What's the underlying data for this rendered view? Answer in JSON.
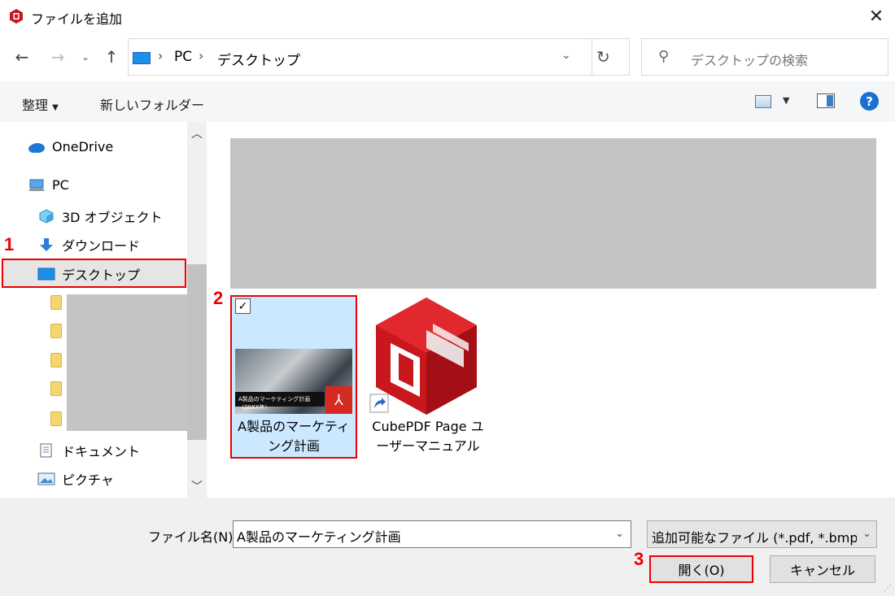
{
  "window": {
    "title": "ファイルを追加"
  },
  "nav": {
    "crumbs": [
      "PC",
      "デスクトップ"
    ],
    "search_placeholder": "デスクトップの検索"
  },
  "toolbar": {
    "organize": "整理",
    "new_folder": "新しいフォルダー"
  },
  "sidebar": {
    "onedrive": "OneDrive",
    "pc": "PC",
    "objects3d": "3D オブジェクト",
    "downloads": "ダウンロード",
    "desktop": "デスクトップ",
    "documents": "ドキュメント",
    "pictures": "ピクチャ"
  },
  "files": [
    {
      "name_line1": "A製品のマーケティ",
      "name_line2": "ング計画",
      "thumb_caption": "A製品のマーケティング計画（20XX年）",
      "selected": true
    },
    {
      "name_line1": "CubePDF Page ユ",
      "name_line2": "ーザーマニュアル",
      "selected": false
    }
  ],
  "steps": {
    "s1": "1",
    "s2": "2",
    "s3": "3"
  },
  "footer": {
    "filename_label": "ファイル名(N):",
    "filename_value": "A製品のマーケティング計画",
    "filetype": "追加可能なファイル (*.pdf, *.bmp, ",
    "open_button": "開く(O)",
    "cancel_button": "キャンセル"
  },
  "colors": {
    "accent": "#e00000",
    "selection": "#cce8ff",
    "brand_red": "#c8171d"
  }
}
